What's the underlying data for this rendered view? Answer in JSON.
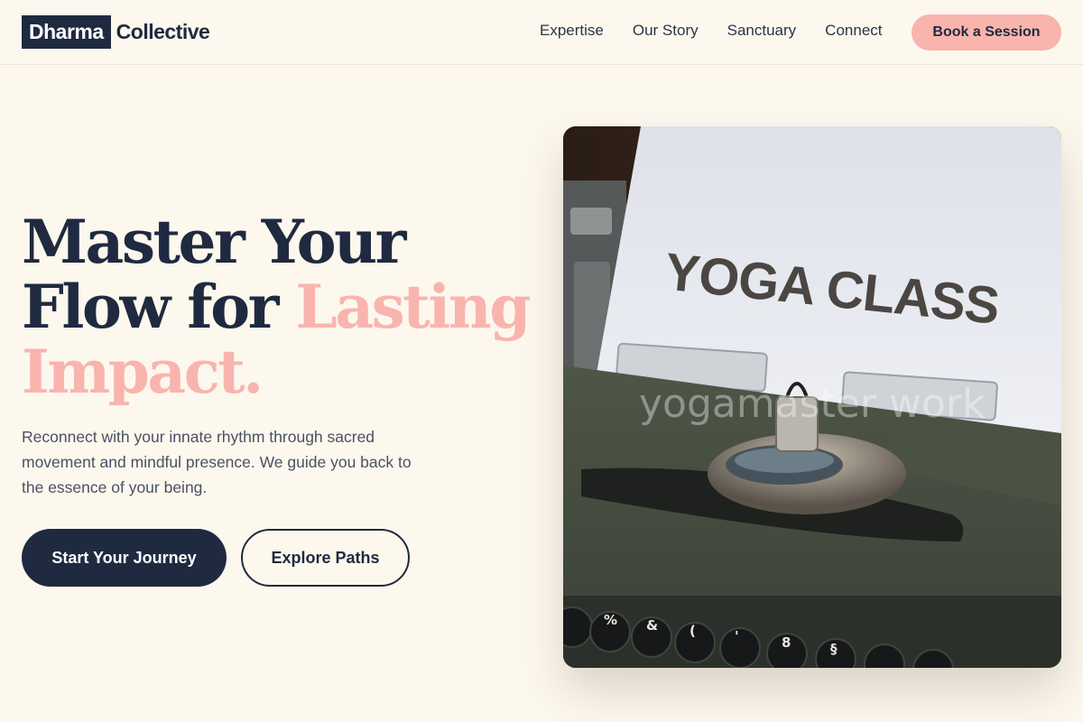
{
  "brand": {
    "logo_box": "Dharma",
    "logo_rest": "Collective"
  },
  "nav": {
    "items": [
      "Expertise",
      "Our Story",
      "Sanctuary",
      "Connect"
    ],
    "cta_label": "Book a Session"
  },
  "hero": {
    "title_line1": "Master Your",
    "title_line2": "Flow for ",
    "title_accent_a": "Lasting",
    "title_accent_b": "Impact.",
    "subtitle": "Reconnect with your innate rhythm through sacred movement and mindful presence. We guide you back to the essence of your being.",
    "primary_button": "Start Your Journey",
    "secondary_button": "Explore Paths"
  },
  "image": {
    "paper_text": "YOGA CLASS",
    "watermark": "yogamaster work"
  },
  "colors": {
    "navy": "#1f2a40",
    "accent": "#f9b4ae",
    "background": "#fdf8ee"
  }
}
